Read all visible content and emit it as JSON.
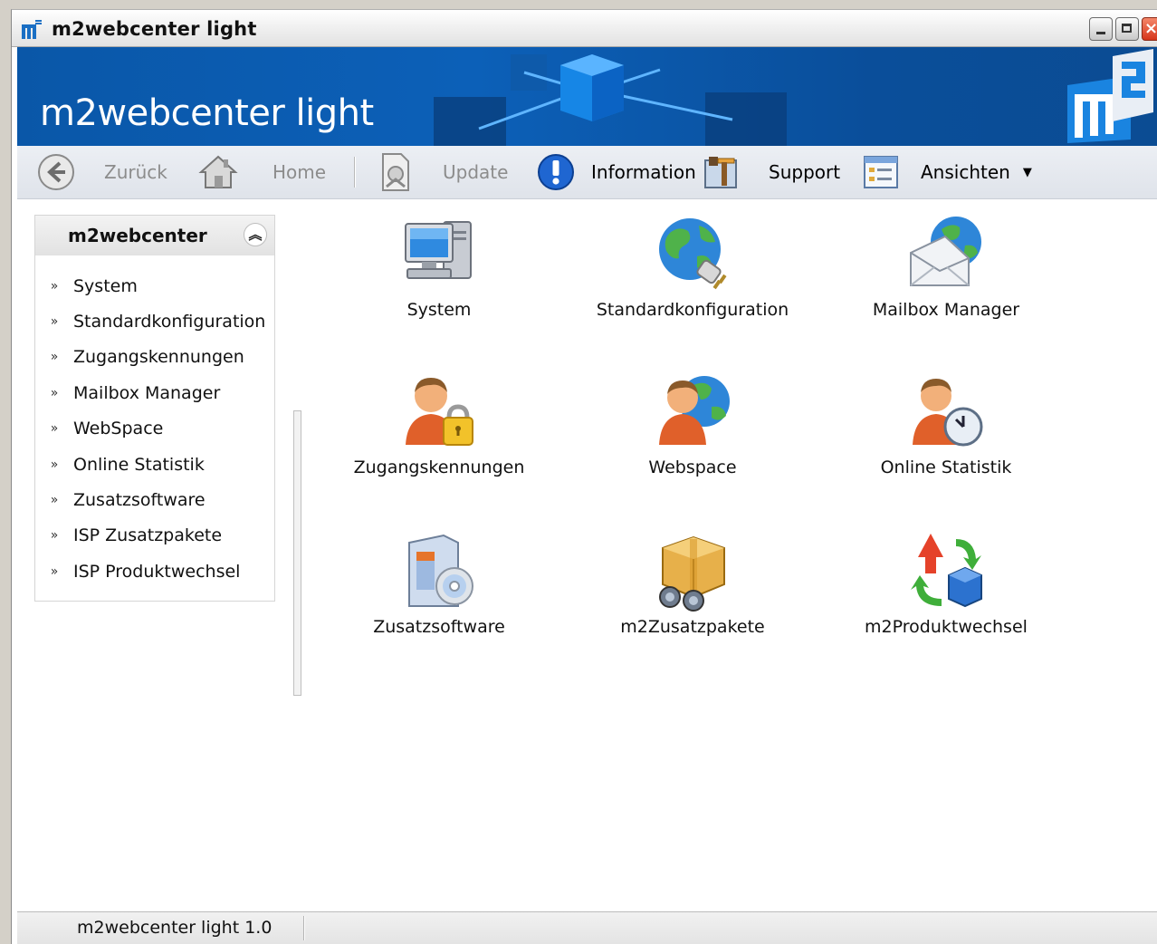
{
  "window": {
    "title": "m2webcenter light"
  },
  "banner": {
    "title": "m2webcenter light"
  },
  "toolbar": {
    "back_label": "Zurück",
    "home_label": "Home",
    "update_label": "Update",
    "info_label": "Information",
    "support_label": "Support",
    "views_label": "Ansichten"
  },
  "sidebar": {
    "title": "m2webcenter",
    "items": [
      {
        "label": "System"
      },
      {
        "label": "Standardkonfiguration"
      },
      {
        "label": "Zugangskennungen"
      },
      {
        "label": "Mailbox Manager"
      },
      {
        "label": "WebSpace"
      },
      {
        "label": "Online Statistik"
      },
      {
        "label": "Zusatzsoftware"
      },
      {
        "label": "ISP Zusatzpakete"
      },
      {
        "label": "ISP Produktwechsel"
      }
    ]
  },
  "tiles": [
    {
      "label": "System",
      "icon": "computer-icon"
    },
    {
      "label": "Standardkonfiguration",
      "icon": "globe-plug-icon"
    },
    {
      "label": "Mailbox Manager",
      "icon": "mail-globe-icon"
    },
    {
      "label": "Zugangskennungen",
      "icon": "user-lock-icon"
    },
    {
      "label": "Webspace",
      "icon": "user-globe-icon"
    },
    {
      "label": "Online Statistik",
      "icon": "user-clock-icon"
    },
    {
      "label": "Zusatzsoftware",
      "icon": "software-cd-icon"
    },
    {
      "label": "m2Zusatzpakete",
      "icon": "package-binoculars-icon"
    },
    {
      "label": "m2Produktwechsel",
      "icon": "cube-arrows-icon"
    }
  ],
  "statusbar": {
    "version": "m2webcenter light 1.0"
  },
  "colors": {
    "banner": "#0c60b8",
    "toolbar": "#e4e7ed"
  }
}
